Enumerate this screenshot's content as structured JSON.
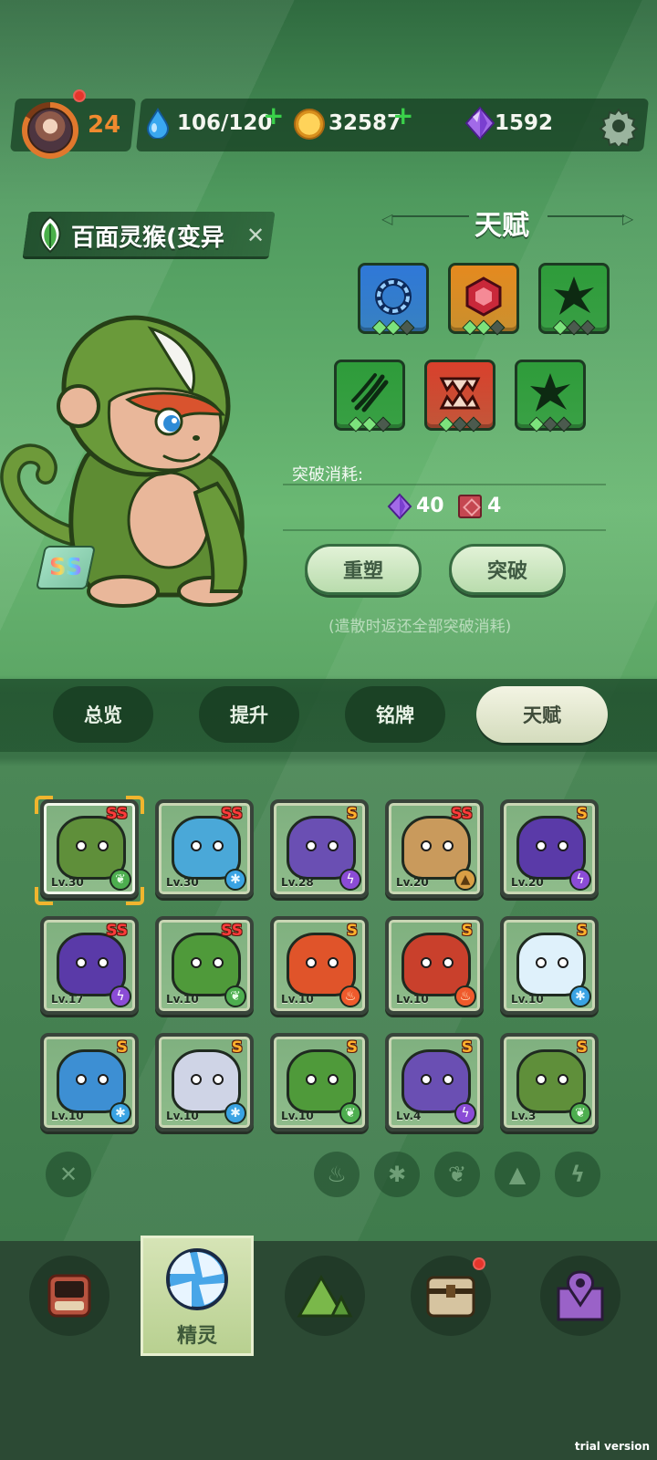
{
  "topbar": {
    "level": "24",
    "stamina": "106/120",
    "coins": "32587",
    "gems": "1592",
    "icons": [
      "avatar",
      "water-drop-icon",
      "paw-coin-icon",
      "purple-gem-icon",
      "gear-icon"
    ]
  },
  "creature": {
    "name": "百面灵猴(变异",
    "rank": "SS",
    "element": "grass"
  },
  "talent": {
    "title": "天赋",
    "slots": [
      {
        "icon": "blue-gear-icon",
        "color": "#2f78d8",
        "pips": [
          1,
          1,
          0
        ]
      },
      {
        "icon": "red-hexagon-icon",
        "color": "#e58a1f",
        "pips": [
          1,
          1,
          0
        ]
      },
      {
        "icon": "green-spiky-icon",
        "color": "#2e9c3a",
        "pips": [
          1,
          0,
          0
        ]
      },
      {
        "icon": "green-claw-icon",
        "color": "#2e9c3a",
        "pips": [
          1,
          1,
          0
        ]
      },
      {
        "icon": "red-fang-icon",
        "color": "#d9402c",
        "pips": [
          1,
          0,
          0
        ]
      },
      {
        "icon": "green-spiky-icon",
        "color": "#2e9c3a",
        "pips": [
          1,
          0,
          0
        ]
      }
    ],
    "cost_label": "突破消耗:",
    "cost_gems": "40",
    "cost_books": "4",
    "reshape_button": "重塑",
    "breakthrough_button": "突破",
    "hint": "(遣散时返还全部突破消耗)"
  },
  "tabs": [
    {
      "label": "总览",
      "active": false
    },
    {
      "label": "提升",
      "active": false
    },
    {
      "label": "铭牌",
      "active": false
    },
    {
      "label": "天赋",
      "active": true
    }
  ],
  "cards": [
    {
      "lv": "Lv.30",
      "rank": "SS",
      "element": "grass",
      "body": "#5f8f3a",
      "selected": true
    },
    {
      "lv": "Lv.30",
      "rank": "SS",
      "element": "water",
      "body": "#4aa8d8"
    },
    {
      "lv": "Lv.28",
      "rank": "S",
      "element": "electric",
      "body": "#6a4fb3"
    },
    {
      "lv": "Lv.20",
      "rank": "SS",
      "element": "earth",
      "body": "#c99a5c"
    },
    {
      "lv": "Lv.20",
      "rank": "S",
      "element": "electric",
      "body": "#5a3aa8"
    },
    {
      "lv": "Lv.17",
      "rank": "SS",
      "element": "electric",
      "body": "#5a3aa8"
    },
    {
      "lv": "Lv.10",
      "rank": "SS",
      "element": "grass",
      "body": "#4f9a3a"
    },
    {
      "lv": "Lv.10",
      "rank": "S",
      "element": "fire",
      "body": "#e0542a"
    },
    {
      "lv": "Lv.10",
      "rank": "S",
      "element": "fire",
      "body": "#c9402c"
    },
    {
      "lv": "Lv.10",
      "rank": "S",
      "element": "water",
      "body": "#dff1fb"
    },
    {
      "lv": "Lv.10",
      "rank": "S",
      "element": "water",
      "body": "#3d8fd3"
    },
    {
      "lv": "Lv.10",
      "rank": "S",
      "element": "water",
      "body": "#cfd4e6"
    },
    {
      "lv": "Lv.10",
      "rank": "S",
      "element": "grass",
      "body": "#4f9a3a"
    },
    {
      "lv": "Lv.4",
      "rank": "S",
      "element": "electric",
      "body": "#6a4fb3"
    },
    {
      "lv": "Lv.3",
      "rank": "S",
      "element": "grass",
      "body": "#5f8f3a"
    }
  ],
  "filters": [
    "close-filter-icon",
    "fire-filter-icon",
    "ice-filter-icon",
    "grass-filter-icon",
    "earth-filter-icon",
    "electric-filter-icon"
  ],
  "nav": {
    "items": [
      "backpack-icon",
      "spirit-icon",
      "mountain-icon",
      "chest-icon",
      "map-pin-icon"
    ],
    "active_label": "精灵"
  },
  "watermark": "trial version"
}
